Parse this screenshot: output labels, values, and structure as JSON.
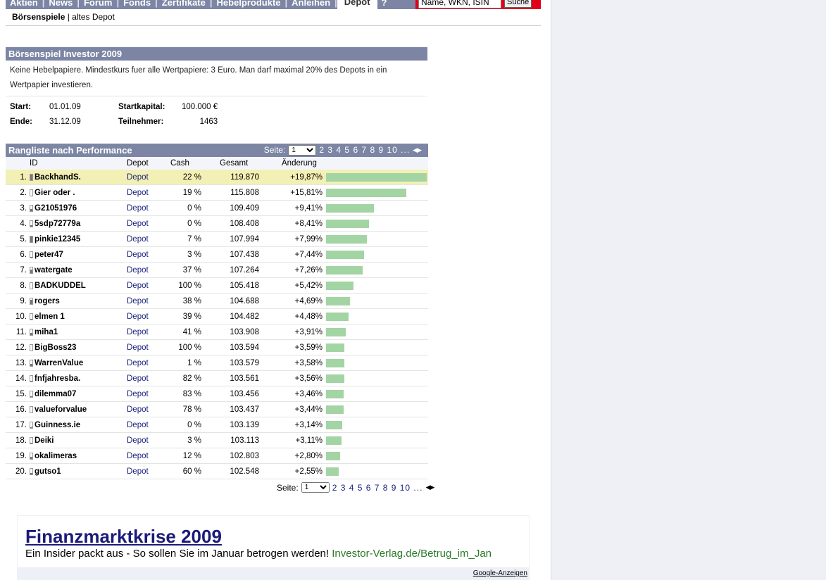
{
  "nav": {
    "items": [
      "Aktien",
      "News",
      "Forum",
      "Fonds",
      "Zertifikate",
      "Hebelprodukte",
      "Anleihen"
    ],
    "active": "Depot",
    "extra": "?"
  },
  "search": {
    "placeholder": "Name, WKN, ISIN",
    "button": "Suche"
  },
  "sub": {
    "active": "Börsenspiele",
    "sep": " | ",
    "other": "altes Depot"
  },
  "game": {
    "title": "Börsenspiel Investor 2009",
    "description": "Keine Hebelpapiere. Mindestkurs fuer alle Wertpapiere: 3 Euro. Man darf maximal 20% des Depots in ein Wertpapier investieren.",
    "start_label": "Start:",
    "start": "01.01.09",
    "end_label": "Ende:",
    "end": "31.12.09",
    "kapital_label": "Startkapital:",
    "kapital": "100.000 €",
    "teil_label": "Teilnehmer:",
    "teil": "1463"
  },
  "ranking": {
    "title": "Rangliste nach Performance",
    "page_label": "Seite:",
    "page_selected": "1",
    "pages": "2 3 4 5 6 7 8 9 10 ...",
    "columns": [
      "ID",
      "Depot",
      "Cash",
      "Gesamt",
      "Änderung"
    ],
    "rows": [
      {
        "rank": "1.",
        "id": "BackhandS.",
        "depot": "Depot",
        "cash": "22 %",
        "gesamt": "119.870",
        "change": "+19,87%",
        "pct": 19.87,
        "activity": 1.0
      },
      {
        "rank": "2.",
        "id": "Gier oder .",
        "depot": "Depot",
        "cash": "19 %",
        "gesamt": "115.808",
        "change": "+15,81%",
        "pct": 15.81,
        "activity": 0
      },
      {
        "rank": "3.",
        "id": "G21051976",
        "depot": "Depot",
        "cash": "0 %",
        "gesamt": "109.409",
        "change": "+9,41%",
        "pct": 9.41,
        "activity": 0.3
      },
      {
        "rank": "4.",
        "id": "5sdp72779a",
        "depot": "Depot",
        "cash": "0 %",
        "gesamt": "108.408",
        "change": "+8,41%",
        "pct": 8.41,
        "activity": 0.2
      },
      {
        "rank": "5.",
        "id": "pinkie12345",
        "depot": "Depot",
        "cash": "7 %",
        "gesamt": "107.994",
        "change": "+7,99%",
        "pct": 7.99,
        "activity": 1.0
      },
      {
        "rank": "6.",
        "id": "peter47",
        "depot": "Depot",
        "cash": "3 %",
        "gesamt": "107.438",
        "change": "+7,44%",
        "pct": 7.44,
        "activity": 0.05
      },
      {
        "rank": "7.",
        "id": "watergate",
        "depot": "Depot",
        "cash": "37 %",
        "gesamt": "107.264",
        "change": "+7,26%",
        "pct": 7.26,
        "activity": 0.6
      },
      {
        "rank": "8.",
        "id": "BADKUDDEL",
        "depot": "Depot",
        "cash": "100 %",
        "gesamt": "105.418",
        "change": "+5,42%",
        "pct": 5.42,
        "activity": 0
      },
      {
        "rank": "9.",
        "id": "rogers",
        "depot": "Depot",
        "cash": "38 %",
        "gesamt": "104.688",
        "change": "+4,69%",
        "pct": 4.69,
        "activity": 0.7
      },
      {
        "rank": "10.",
        "id": "elmen 1",
        "depot": "Depot",
        "cash": "39 %",
        "gesamt": "104.482",
        "change": "+4,48%",
        "pct": 4.48,
        "activity": 0.1
      },
      {
        "rank": "11.",
        "id": "miha1",
        "depot": "Depot",
        "cash": "41 %",
        "gesamt": "103.908",
        "change": "+3,91%",
        "pct": 3.91,
        "activity": 0.3
      },
      {
        "rank": "12.",
        "id": "BigBoss23",
        "depot": "Depot",
        "cash": "100 %",
        "gesamt": "103.594",
        "change": "+3,59%",
        "pct": 3.59,
        "activity": 0
      },
      {
        "rank": "13.",
        "id": "WarrenValue",
        "depot": "Depot",
        "cash": "1 %",
        "gesamt": "103.579",
        "change": "+3,58%",
        "pct": 3.58,
        "activity": 0.3
      },
      {
        "rank": "14.",
        "id": "fnfjahresba.",
        "depot": "Depot",
        "cash": "82 %",
        "gesamt": "103.561",
        "change": "+3,56%",
        "pct": 3.56,
        "activity": 0.05
      },
      {
        "rank": "15.",
        "id": "dilemma07",
        "depot": "Depot",
        "cash": "83 %",
        "gesamt": "103.456",
        "change": "+3,46%",
        "pct": 3.46,
        "activity": 0.05
      },
      {
        "rank": "16.",
        "id": "valueforvalue",
        "depot": "Depot",
        "cash": "78 %",
        "gesamt": "103.437",
        "change": "+3,44%",
        "pct": 3.44,
        "activity": 0
      },
      {
        "rank": "17.",
        "id": "Guinness.ie",
        "depot": "Depot",
        "cash": "0 %",
        "gesamt": "103.139",
        "change": "+3,14%",
        "pct": 3.14,
        "activity": 0.1
      },
      {
        "rank": "18.",
        "id": "Deiki",
        "depot": "Depot",
        "cash": "3 %",
        "gesamt": "103.113",
        "change": "+3,11%",
        "pct": 3.11,
        "activity": 0.05
      },
      {
        "rank": "19.",
        "id": "okalimeras",
        "depot": "Depot",
        "cash": "12 %",
        "gesamt": "102.803",
        "change": "+2,80%",
        "pct": 2.8,
        "activity": 0.3
      },
      {
        "rank": "20.",
        "id": "gutso1",
        "depot": "Depot",
        "cash": "60 %",
        "gesamt": "102.548",
        "change": "+2,55%",
        "pct": 2.55,
        "activity": 0.2
      }
    ]
  },
  "ad": {
    "title": "Finanzmarktkrise 2009",
    "text": "Ein Insider packt aus - So sollen Sie im Januar betrogen werden! ",
    "link": "Investor-Verlag.de/Betrug_im_Jan",
    "google": "Google-Anzeigen"
  }
}
